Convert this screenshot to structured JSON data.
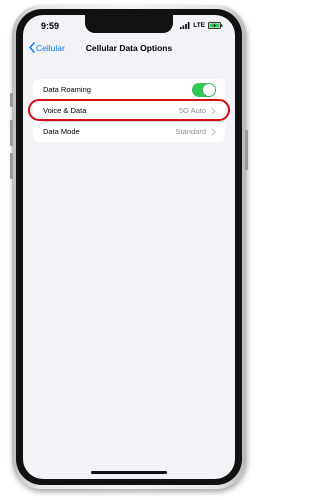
{
  "status_bar": {
    "time": "9:59",
    "network": "LTE",
    "icons": [
      "signal-icon",
      "battery-charging-icon"
    ]
  },
  "nav": {
    "back_label": "Cellular",
    "title": "Cellular Data Options",
    "back_icon": "chevron-left-icon"
  },
  "settings": {
    "rows": [
      {
        "label": "Data Roaming",
        "toggle_on": true
      },
      {
        "label": "Voice & Data",
        "value": "5G Auto",
        "highlighted": true
      },
      {
        "label": "Data Mode",
        "value": "Standard"
      }
    ]
  },
  "colors": {
    "accent": "#0a7aff",
    "toggle_on": "#34c759",
    "highlight": "#d50f16",
    "background": "#f2f2f7"
  }
}
